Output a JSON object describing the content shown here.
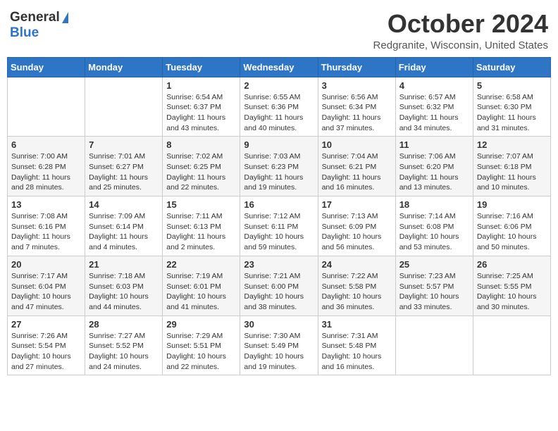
{
  "header": {
    "logo_general": "General",
    "logo_blue": "Blue",
    "month_title": "October 2024",
    "location": "Redgranite, Wisconsin, United States"
  },
  "weekdays": [
    "Sunday",
    "Monday",
    "Tuesday",
    "Wednesday",
    "Thursday",
    "Friday",
    "Saturday"
  ],
  "weeks": [
    [
      {
        "day": "",
        "info": ""
      },
      {
        "day": "",
        "info": ""
      },
      {
        "day": "1",
        "info": "Sunrise: 6:54 AM\nSunset: 6:37 PM\nDaylight: 11 hours and 43 minutes."
      },
      {
        "day": "2",
        "info": "Sunrise: 6:55 AM\nSunset: 6:36 PM\nDaylight: 11 hours and 40 minutes."
      },
      {
        "day": "3",
        "info": "Sunrise: 6:56 AM\nSunset: 6:34 PM\nDaylight: 11 hours and 37 minutes."
      },
      {
        "day": "4",
        "info": "Sunrise: 6:57 AM\nSunset: 6:32 PM\nDaylight: 11 hours and 34 minutes."
      },
      {
        "day": "5",
        "info": "Sunrise: 6:58 AM\nSunset: 6:30 PM\nDaylight: 11 hours and 31 minutes."
      }
    ],
    [
      {
        "day": "6",
        "info": "Sunrise: 7:00 AM\nSunset: 6:28 PM\nDaylight: 11 hours and 28 minutes."
      },
      {
        "day": "7",
        "info": "Sunrise: 7:01 AM\nSunset: 6:27 PM\nDaylight: 11 hours and 25 minutes."
      },
      {
        "day": "8",
        "info": "Sunrise: 7:02 AM\nSunset: 6:25 PM\nDaylight: 11 hours and 22 minutes."
      },
      {
        "day": "9",
        "info": "Sunrise: 7:03 AM\nSunset: 6:23 PM\nDaylight: 11 hours and 19 minutes."
      },
      {
        "day": "10",
        "info": "Sunrise: 7:04 AM\nSunset: 6:21 PM\nDaylight: 11 hours and 16 minutes."
      },
      {
        "day": "11",
        "info": "Sunrise: 7:06 AM\nSunset: 6:20 PM\nDaylight: 11 hours and 13 minutes."
      },
      {
        "day": "12",
        "info": "Sunrise: 7:07 AM\nSunset: 6:18 PM\nDaylight: 11 hours and 10 minutes."
      }
    ],
    [
      {
        "day": "13",
        "info": "Sunrise: 7:08 AM\nSunset: 6:16 PM\nDaylight: 11 hours and 7 minutes."
      },
      {
        "day": "14",
        "info": "Sunrise: 7:09 AM\nSunset: 6:14 PM\nDaylight: 11 hours and 4 minutes."
      },
      {
        "day": "15",
        "info": "Sunrise: 7:11 AM\nSunset: 6:13 PM\nDaylight: 11 hours and 2 minutes."
      },
      {
        "day": "16",
        "info": "Sunrise: 7:12 AM\nSunset: 6:11 PM\nDaylight: 10 hours and 59 minutes."
      },
      {
        "day": "17",
        "info": "Sunrise: 7:13 AM\nSunset: 6:09 PM\nDaylight: 10 hours and 56 minutes."
      },
      {
        "day": "18",
        "info": "Sunrise: 7:14 AM\nSunset: 6:08 PM\nDaylight: 10 hours and 53 minutes."
      },
      {
        "day": "19",
        "info": "Sunrise: 7:16 AM\nSunset: 6:06 PM\nDaylight: 10 hours and 50 minutes."
      }
    ],
    [
      {
        "day": "20",
        "info": "Sunrise: 7:17 AM\nSunset: 6:04 PM\nDaylight: 10 hours and 47 minutes."
      },
      {
        "day": "21",
        "info": "Sunrise: 7:18 AM\nSunset: 6:03 PM\nDaylight: 10 hours and 44 minutes."
      },
      {
        "day": "22",
        "info": "Sunrise: 7:19 AM\nSunset: 6:01 PM\nDaylight: 10 hours and 41 minutes."
      },
      {
        "day": "23",
        "info": "Sunrise: 7:21 AM\nSunset: 6:00 PM\nDaylight: 10 hours and 38 minutes."
      },
      {
        "day": "24",
        "info": "Sunrise: 7:22 AM\nSunset: 5:58 PM\nDaylight: 10 hours and 36 minutes."
      },
      {
        "day": "25",
        "info": "Sunrise: 7:23 AM\nSunset: 5:57 PM\nDaylight: 10 hours and 33 minutes."
      },
      {
        "day": "26",
        "info": "Sunrise: 7:25 AM\nSunset: 5:55 PM\nDaylight: 10 hours and 30 minutes."
      }
    ],
    [
      {
        "day": "27",
        "info": "Sunrise: 7:26 AM\nSunset: 5:54 PM\nDaylight: 10 hours and 27 minutes."
      },
      {
        "day": "28",
        "info": "Sunrise: 7:27 AM\nSunset: 5:52 PM\nDaylight: 10 hours and 24 minutes."
      },
      {
        "day": "29",
        "info": "Sunrise: 7:29 AM\nSunset: 5:51 PM\nDaylight: 10 hours and 22 minutes."
      },
      {
        "day": "30",
        "info": "Sunrise: 7:30 AM\nSunset: 5:49 PM\nDaylight: 10 hours and 19 minutes."
      },
      {
        "day": "31",
        "info": "Sunrise: 7:31 AM\nSunset: 5:48 PM\nDaylight: 10 hours and 16 minutes."
      },
      {
        "day": "",
        "info": ""
      },
      {
        "day": "",
        "info": ""
      }
    ]
  ]
}
